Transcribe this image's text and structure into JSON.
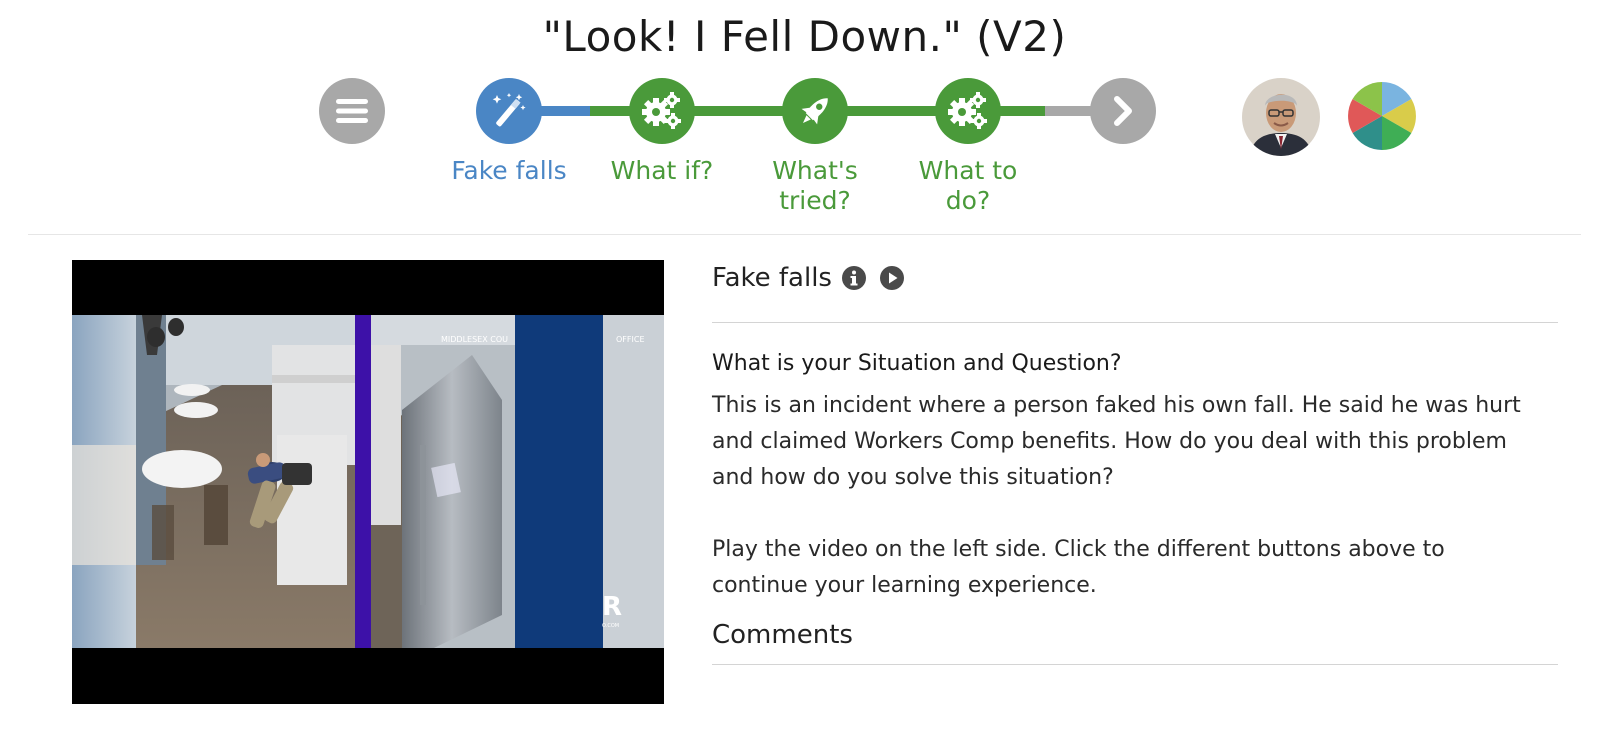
{
  "page": {
    "title": "\"Look! I Fell Down.\" (V2)"
  },
  "nav": {
    "menu_icon": "hamburger-menu-icon",
    "steps": [
      {
        "label_line1": "Fake falls",
        "label_line2": "",
        "icon": "magic-wand-icon",
        "color": "#4a86c5",
        "active": true
      },
      {
        "label_line1": "What if?",
        "label_line2": "",
        "icon": "gears-icon",
        "color": "#4a9a3a",
        "active": false
      },
      {
        "label_line1": "What's",
        "label_line2": "tried?",
        "icon": "rocket-icon",
        "color": "#4a9a3a",
        "active": false
      },
      {
        "label_line1": "What to",
        "label_line2": "do?",
        "icon": "gears-icon",
        "color": "#4a9a3a",
        "active": false
      }
    ],
    "next_icon": "chevron-right-icon",
    "colors": {
      "inactive": "#a8a8a8",
      "active": "#4a86c5",
      "green": "#4a9a3a"
    }
  },
  "video": {
    "watermark_left": "MIDDLESEX COU",
    "watermark_right": "OFFICE",
    "corner_logo": "R",
    "corner_text": "O.COM"
  },
  "panel": {
    "section_title": "Fake falls",
    "info_icon": "info-circle-icon",
    "play_icon": "play-circle-icon",
    "question_heading": "What is your Situation and Question?",
    "paragraph1_lines": [
      "This is an incident where a person faked his own fall. He said he was hurt",
      "and claimed Workers Comp benefits. How do you deal with this problem",
      "and how do you solve this situation?"
    ],
    "paragraph2_lines": [
      "Play the video on the left side. Click the different buttons above to",
      "continue your learning experience."
    ],
    "comments_label": "Comments"
  }
}
